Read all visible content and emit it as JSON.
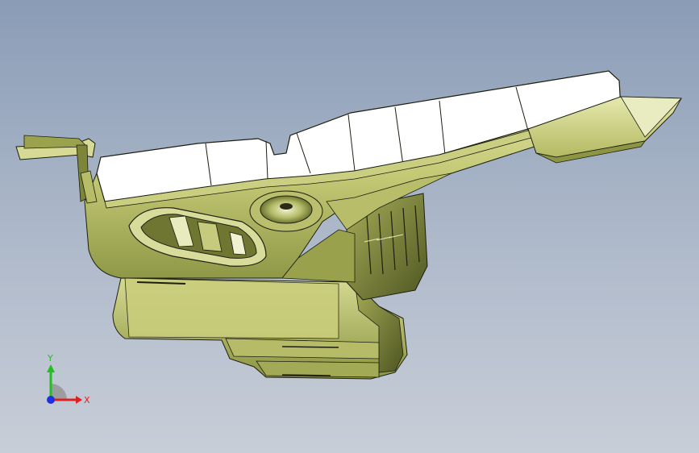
{
  "viewport": {
    "background_top": "#8a9cb6",
    "background_bottom": "#c8ced8"
  },
  "model": {
    "body_color": "#c8cc7a",
    "shadow_color": "#7f8a3c",
    "top_face_color": "#ffffff",
    "edge_color": "#1c1e10"
  },
  "triad": {
    "x_label": "X",
    "y_label": "Y",
    "x_color": "#e02020",
    "y_color": "#20c020",
    "z_color": "#2030e0"
  }
}
